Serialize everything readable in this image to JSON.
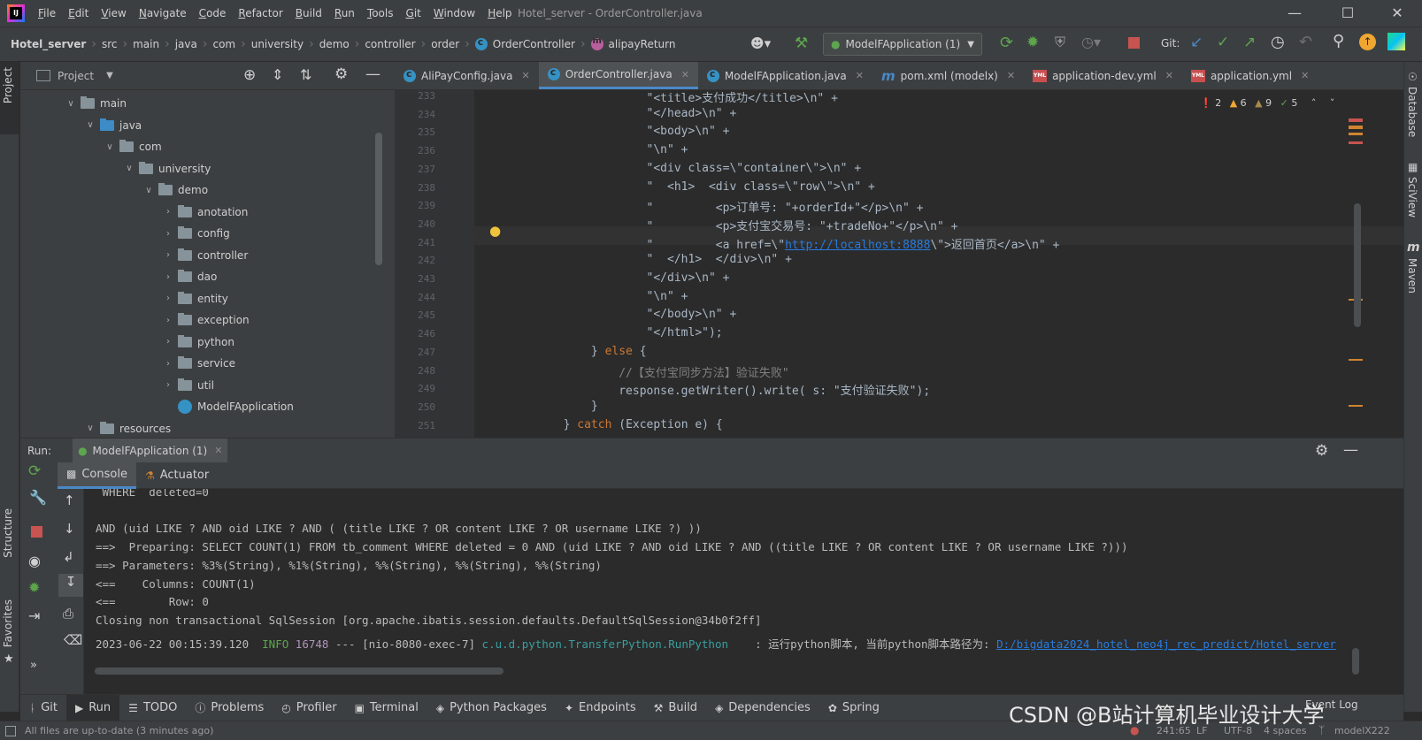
{
  "menubar": {
    "items": [
      "File",
      "Edit",
      "View",
      "Navigate",
      "Code",
      "Refactor",
      "Build",
      "Run",
      "Tools",
      "Git",
      "Window",
      "Help"
    ],
    "title": "Hotel_server - OrderController.java"
  },
  "navbar": {
    "crumbs": [
      "Hotel_server",
      "src",
      "main",
      "java",
      "com",
      "university",
      "demo",
      "controller",
      "order",
      "OrderController",
      "alipayReturn"
    ],
    "run_config": "ModelFApplication (1)",
    "git_label": "Git:"
  },
  "left_strip": {
    "project": "Project",
    "structure": "Structure",
    "favorites": "Favorites"
  },
  "right_strip": {
    "database": "Database",
    "sciview": "SciView",
    "maven": "Maven"
  },
  "project": {
    "header": "Project",
    "tree": [
      {
        "label": "main",
        "depth": 0,
        "open": true,
        "blue": false
      },
      {
        "label": "java",
        "depth": 1,
        "open": true,
        "blue": true
      },
      {
        "label": "com",
        "depth": 2,
        "open": true,
        "blue": false
      },
      {
        "label": "university",
        "depth": 3,
        "open": true,
        "blue": false
      },
      {
        "label": "demo",
        "depth": 4,
        "open": true,
        "blue": false
      },
      {
        "label": "anotation",
        "depth": 5,
        "open": false,
        "blue": false
      },
      {
        "label": "config",
        "depth": 5,
        "open": false,
        "blue": false
      },
      {
        "label": "controller",
        "depth": 5,
        "open": false,
        "blue": false
      },
      {
        "label": "dao",
        "depth": 5,
        "open": false,
        "blue": false
      },
      {
        "label": "entity",
        "depth": 5,
        "open": false,
        "blue": false
      },
      {
        "label": "exception",
        "depth": 5,
        "open": false,
        "blue": false
      },
      {
        "label": "python",
        "depth": 5,
        "open": false,
        "blue": false
      },
      {
        "label": "service",
        "depth": 5,
        "open": false,
        "blue": false
      },
      {
        "label": "util",
        "depth": 5,
        "open": false,
        "blue": false
      },
      {
        "label": "ModelFApplication",
        "depth": 5,
        "open": false,
        "blue": false,
        "file": true
      },
      {
        "label": "resources",
        "depth": 1,
        "open": true,
        "blue": false
      }
    ]
  },
  "editor": {
    "tabs": [
      {
        "label": "AliPayConfig.java",
        "icon": "c"
      },
      {
        "label": "OrderController.java",
        "icon": "c",
        "active": true
      },
      {
        "label": "ModelFApplication.java",
        "icon": "app"
      },
      {
        "label": "pom.xml (modelx)",
        "icon": "m"
      },
      {
        "label": "application-dev.yml",
        "icon": "yml"
      },
      {
        "label": "application.yml",
        "icon": "yml"
      }
    ],
    "indicators": {
      "errors": "2",
      "warnings": "6",
      "weak": "9",
      "ok": "5"
    },
    "line_numbers": [
      "233",
      "234",
      "235",
      "236",
      "237",
      "238",
      "239",
      "240",
      "241",
      "242",
      "243",
      "244",
      "245",
      "246",
      "247",
      "248",
      "249",
      "250",
      "251"
    ],
    "lines": [
      "                    \"<title>支付成功</title>\\n\" +",
      "                    \"</head>\\n\" +",
      "                    \"<body>\\n\" +",
      "                    \"\\n\" +",
      "                    \"<div class=\\\"container\\\">\\n\" +",
      "                    \"  <h1>  <div class=\\\"row\\\">\\n\" +",
      "                    \"         <p>订单号: \"+orderId+\"</p>\\n\" +",
      "                    \"         <p>支付宝交易号: \"+tradeNo+\"</p>\\n\" +",
      "                    \"         <a href=\\\"http://localhost:8888\\\">返回首页</a>\\n\" +",
      "                    \"  </h1>  </div>\\n\" +",
      "                    \"</div>\\n\" +",
      "                    \"\\n\" +",
      "                    \"</body>\\n\" +",
      "                    \"</html>\");",
      "            } else {",
      "                //【支付宝同步方法】验证失败\"",
      "                response.getWriter().write( s: \"支付验证失败\");",
      "            }",
      "        } catch (Exception e) {"
    ]
  },
  "run": {
    "label": "Run:",
    "config": "ModelFApplication (1)",
    "subtabs": [
      "Console",
      "Actuator"
    ],
    "console": [
      " WHERE  deleted=0",
      "",
      "AND (uid LIKE ? AND oid LIKE ? AND ( (title LIKE ? OR content LIKE ? OR username LIKE ?) ))",
      "==>  Preparing: SELECT COUNT(1) FROM tb_comment WHERE deleted = 0 AND (uid LIKE ? AND oid LIKE ? AND ((title LIKE ? OR content LIKE ? OR username LIKE ?)))",
      "==> Parameters: %3%(String), %1%(String), %%(String), %%(String), %%(String)",
      "<==    Columns: COUNT(1)",
      "<==        Row: 0",
      "Closing non transactional SqlSession [org.apache.ibatis.session.defaults.DefaultSqlSession@34b0f2ff]"
    ],
    "log": {
      "time": "2023-06-22 00:15:39.120",
      "level": "INFO",
      "pid": "16748",
      "sep": "---",
      "thread": "[nio-8080-exec-7]",
      "logger": "c.u.d.python.TransferPython.RunPython",
      "msg": "   : 运行python脚本, 当前python脚本路径为: ",
      "path": "D:/bigdata2024_hotel_neo4j_rec_predict/Hotel_server"
    }
  },
  "bottom_tabs": [
    "Git",
    "Run",
    "TODO",
    "Problems",
    "Profiler",
    "Terminal",
    "Python Packages",
    "Endpoints",
    "Build",
    "Dependencies",
    "Spring"
  ],
  "status": {
    "message": "All files are up-to-date (3 minutes ago)",
    "position": "241:65",
    "line_sep": "LF",
    "encoding": "UTF-8",
    "indent": "4 spaces",
    "branch": "modelX222",
    "event_log": "Event Log"
  },
  "watermark": "CSDN @B站计算机毕业设计大学"
}
